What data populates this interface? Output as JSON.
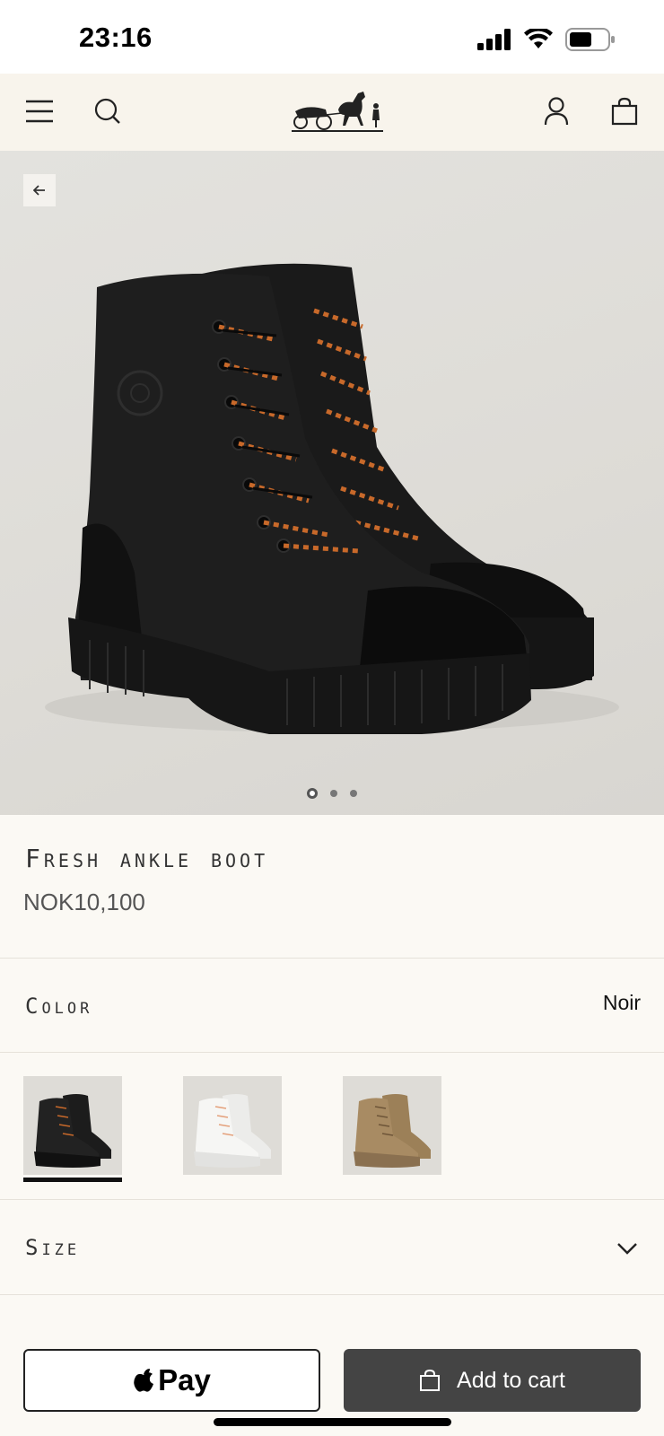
{
  "status_bar": {
    "time": "23:16"
  },
  "header": {
    "menu_icon": "hamburger-icon",
    "search_icon": "search-icon",
    "logo": "hermes-carriage-logo",
    "account_icon": "user-icon",
    "cart_icon": "shopping-bag-icon"
  },
  "gallery": {
    "image_count": 3,
    "active_index": 0
  },
  "product": {
    "title": "Fresh ankle boot",
    "price": "NOK10,100"
  },
  "color": {
    "label": "Color",
    "selected": "Noir",
    "swatches": [
      {
        "name": "Noir",
        "hex": "#1c1c1c",
        "selected": true
      },
      {
        "name": "white",
        "hex": "#f2f2f0",
        "selected": false
      },
      {
        "name": "beige",
        "hex": "#a88b63",
        "selected": false
      }
    ]
  },
  "size": {
    "label": "Size"
  },
  "actions": {
    "apple_pay_label": "Pay",
    "add_to_cart_label": "Add to cart"
  },
  "colors": {
    "header_bg": "#f8f4ec",
    "page_bg": "#fbf9f4",
    "cart_button_bg": "#444444"
  }
}
